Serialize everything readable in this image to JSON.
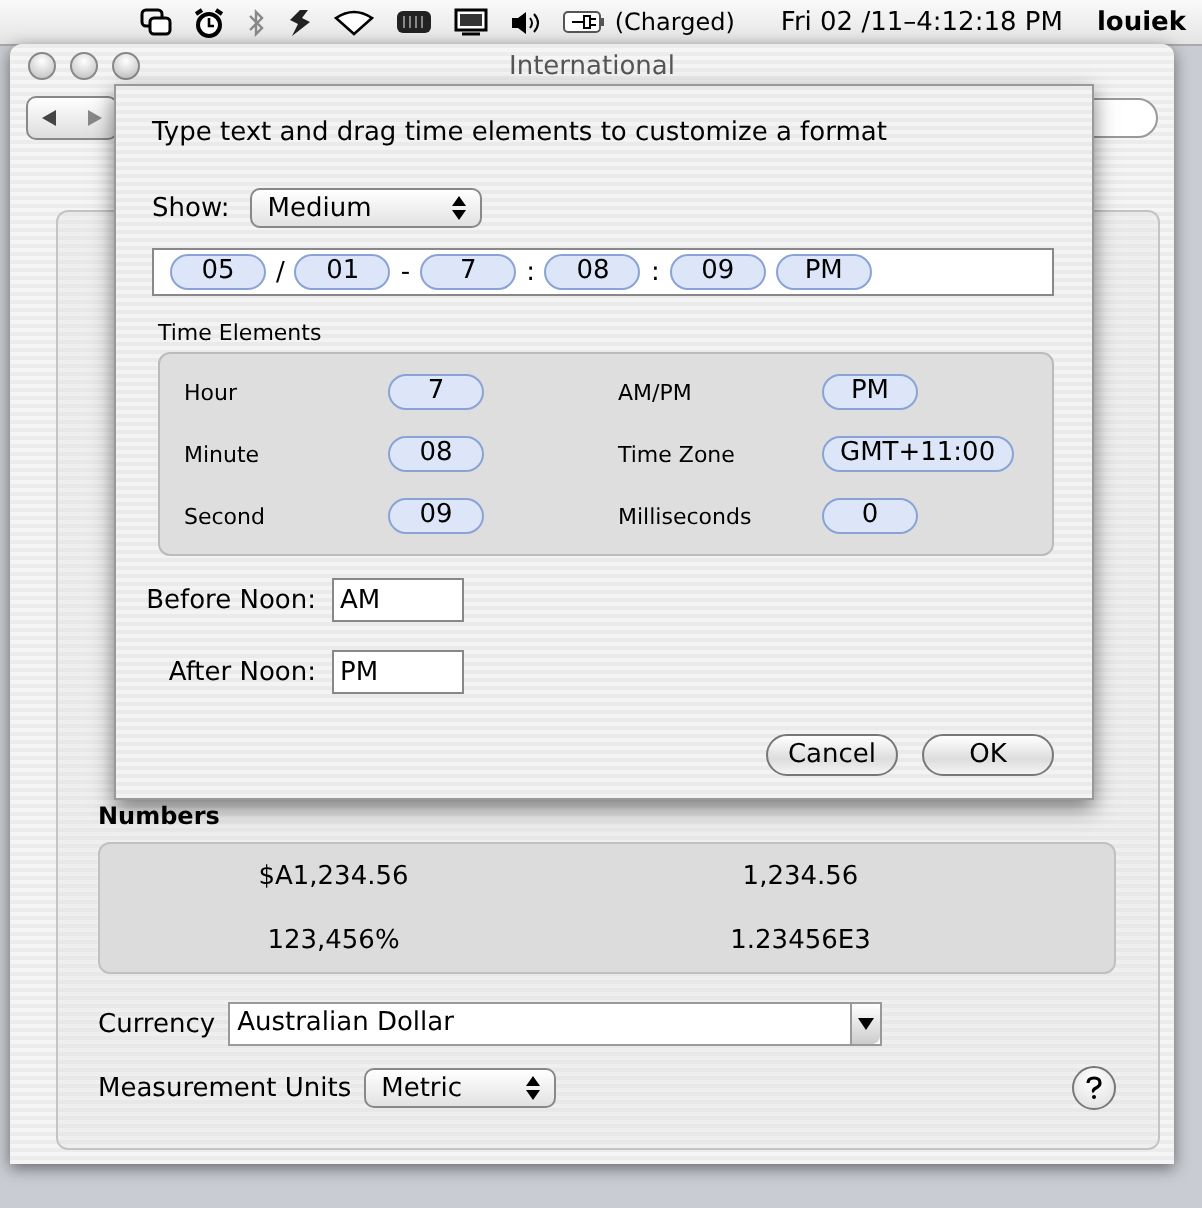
{
  "menubar": {
    "battery_status": "(Charged)",
    "clock": "Fri 02 /11–4:12:18 PM",
    "user": "louiek"
  },
  "window": {
    "title": "International"
  },
  "sheet": {
    "instruction": "Type text and drag time elements to customize a format",
    "show_label": "Show:",
    "show_value": "Medium",
    "format": [
      {
        "kind": "token",
        "text": "05"
      },
      {
        "kind": "text",
        "text": "/"
      },
      {
        "kind": "token",
        "text": "01"
      },
      {
        "kind": "text",
        "text": "-"
      },
      {
        "kind": "token",
        "text": "7"
      },
      {
        "kind": "text",
        "text": ":"
      },
      {
        "kind": "token",
        "text": "08"
      },
      {
        "kind": "text",
        "text": ":"
      },
      {
        "kind": "token",
        "text": "09"
      },
      {
        "kind": "token",
        "text": "PM"
      }
    ],
    "time_elements": {
      "title": "Time Elements",
      "items": [
        {
          "label": "Hour",
          "value": "7"
        },
        {
          "label": "AM/PM",
          "value": "PM"
        },
        {
          "label": "Minute",
          "value": "08"
        },
        {
          "label": "Time Zone",
          "value": "GMT+11:00"
        },
        {
          "label": "Second",
          "value": "09"
        },
        {
          "label": "Milliseconds",
          "value": "0"
        }
      ]
    },
    "before_noon": {
      "label": "Before Noon:",
      "value": "AM"
    },
    "after_noon": {
      "label": "After Noon:",
      "value": "PM"
    },
    "buttons": [
      "Cancel",
      "OK"
    ]
  },
  "numbers": {
    "title": "Numbers",
    "samples": [
      "$A1,234.56",
      "1,234.56",
      "123,456%",
      "1.23456E3"
    ],
    "currency": {
      "label": "Currency",
      "value": "Australian Dollar"
    },
    "measurement": {
      "label": "Measurement Units",
      "value": "Metric"
    }
  }
}
